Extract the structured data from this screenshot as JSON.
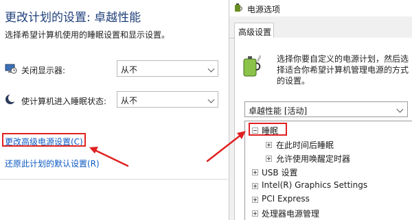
{
  "left_panel": {
    "title": "更改计划的设置: 卓越性能",
    "subtitle": "选择希望计算机使用的睡眠设置和显示设置。",
    "display_off": {
      "label": "关闭显示器:",
      "value": "从不"
    },
    "sleep": {
      "label": "使计算机进入睡眠状态:",
      "value": "从不"
    },
    "advanced_link": "更改高级电源设置(C)",
    "restore_link": "还原此计划的默认设置(R)"
  },
  "dialog": {
    "title": "电源选项",
    "tab": "高级设置",
    "description": "选择你要自定义的电源计划，然后选择适合你希望计算机管理电源的方式的设置。",
    "plan": "卓越性能 [活动]",
    "tree": {
      "sleep": "睡眠",
      "sleep_after": "在此时间后睡眠",
      "wake_timers": "允许使用唤醒定时器",
      "usb": "USB 设置",
      "intel": "Intel(R) Graphics Settings",
      "pci": "PCI Express",
      "cpu": "处理器电源管理"
    }
  },
  "colors": {
    "accent_link": "#0b58c2",
    "highlight": "#e02020"
  }
}
